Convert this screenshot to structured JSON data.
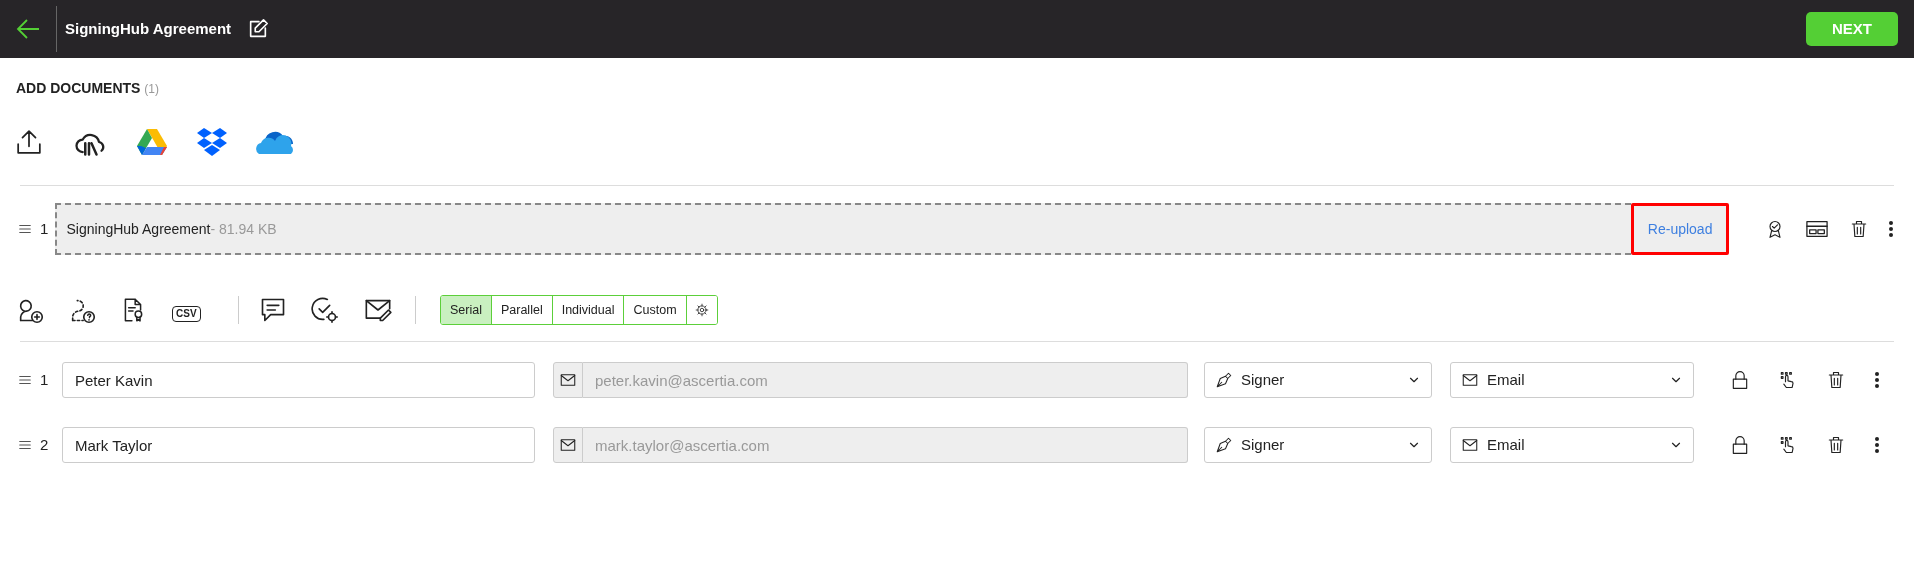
{
  "header": {
    "title": "SigningHub Agreement",
    "next_button": "NEXT"
  },
  "section": {
    "title": "ADD DOCUMENTS",
    "count": "(1)"
  },
  "upload_sources": [
    {
      "kind": "upload"
    },
    {
      "kind": "library"
    },
    {
      "kind": "gdrive"
    },
    {
      "kind": "dropbox"
    },
    {
      "kind": "onedrive"
    }
  ],
  "documents": [
    {
      "index": "1",
      "name": "SigningHub Agreement",
      "size": "- 81.94 KB",
      "action": "Re-upload",
      "highlighted": true
    }
  ],
  "toolbar_groups": [
    [
      {
        "kind": "add-recipient"
      },
      {
        "kind": "placeholder"
      },
      {
        "kind": "certificate"
      },
      {
        "kind": "csv",
        "label": "CSV"
      }
    ],
    [
      {
        "kind": "comment"
      },
      {
        "kind": "settings-check"
      },
      {
        "kind": "mail-edit"
      }
    ]
  ],
  "workflow_modes": [
    {
      "label": "Serial",
      "selected": true
    },
    {
      "label": "Parallel",
      "selected": false
    },
    {
      "label": "Individual",
      "selected": false
    },
    {
      "label": "Custom",
      "selected": false
    }
  ],
  "recipients": [
    {
      "index": "1",
      "name": "Peter Kavin",
      "email": "peter.kavin@ascertia.com",
      "role": "Signer",
      "delivery": "Email"
    },
    {
      "index": "2",
      "name": "Mark Taylor",
      "email": "mark.taylor@ascertia.com",
      "role": "Signer",
      "delivery": "Email"
    }
  ]
}
